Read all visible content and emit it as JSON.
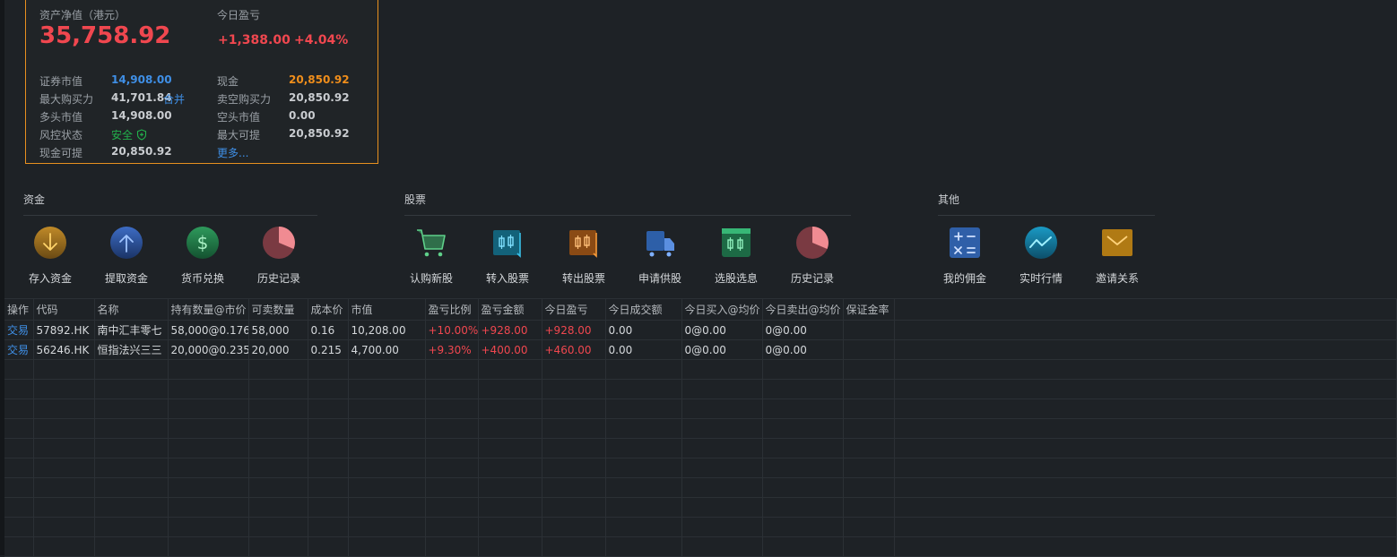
{
  "account": {
    "net_label": "资产净值（港元）",
    "net_value": "35,758.92",
    "today_pl_label": "今日盈亏",
    "today_pl_value": "+1,388.00",
    "today_pl_pct": "+4.04%",
    "rows": [
      {
        "l1": "证券市值",
        "v1": "14,908.00",
        "l2": "现金",
        "v2": "20,850.92"
      },
      {
        "l1": "最大购买力",
        "v1": "41,701.84",
        "extra": "合并",
        "l2": "卖空购买力",
        "v2": "20,850.92"
      },
      {
        "l1": "多头市值",
        "v1": "14,908.00",
        "l2": "空头市值",
        "v2": "0.00"
      },
      {
        "l1": "风控状态",
        "v1": "安全",
        "l2": "最大可提",
        "v2": "20,850.92"
      },
      {
        "l1": "现金可提",
        "v1": "20,850.92",
        "l2": "更多..."
      }
    ]
  },
  "sections": {
    "funds": {
      "title": "资金",
      "items": [
        {
          "label": "存入资金",
          "icon": "deposit-icon"
        },
        {
          "label": "提取资金",
          "icon": "withdraw-icon"
        },
        {
          "label": "货币兑换",
          "icon": "currency-exchange-icon"
        },
        {
          "label": "历史记录",
          "icon": "history-pie-icon"
        }
      ]
    },
    "stocks": {
      "title": "股票",
      "items": [
        {
          "label": "认购新股",
          "icon": "cart-icon"
        },
        {
          "label": "转入股票",
          "icon": "transfer-in-icon"
        },
        {
          "label": "转出股票",
          "icon": "transfer-out-icon"
        },
        {
          "label": "申请供股",
          "icon": "truck-icon"
        },
        {
          "label": "选股选息",
          "icon": "stock-select-icon"
        },
        {
          "label": "历史记录",
          "icon": "history-pie-icon"
        }
      ]
    },
    "other": {
      "title": "其他",
      "items": [
        {
          "label": "我的佣金",
          "icon": "calculator-icon"
        },
        {
          "label": "实时行情",
          "icon": "realtime-quote-icon"
        },
        {
          "label": "邀请关系",
          "icon": "envelope-icon"
        }
      ]
    }
  },
  "positions": {
    "headers": [
      "操作",
      "代码",
      "名称",
      "持有数量@市价",
      "可卖数量",
      "成本价",
      "市值",
      "盈亏比例",
      "盈亏金额",
      "今日盈亏",
      "今日成交额",
      "今日买入@均价",
      "今日卖出@均价",
      "保证金率"
    ],
    "rows": [
      [
        "交易",
        "57892.HK",
        "南中汇丰零七",
        "58,000@0.176",
        "58,000",
        "0.16",
        "10,208.00",
        "+10.00%",
        "+928.00",
        "+928.00",
        "0.00",
        "0@0.00",
        "0@0.00",
        ""
      ],
      [
        "交易",
        "56246.HK",
        "恒指法兴三三",
        "20,000@0.235",
        "20,000",
        "0.215",
        "4,700.00",
        "+9.30%",
        "+400.00",
        "+460.00",
        "0.00",
        "0@0.00",
        "0@0.00",
        ""
      ]
    ]
  },
  "colors": {
    "accent_border": "#e8901f",
    "up_red": "#f0474f",
    "link_blue": "#3f8fe6",
    "safe_green": "#22b14c",
    "cash_orange": "#f08e1b"
  }
}
